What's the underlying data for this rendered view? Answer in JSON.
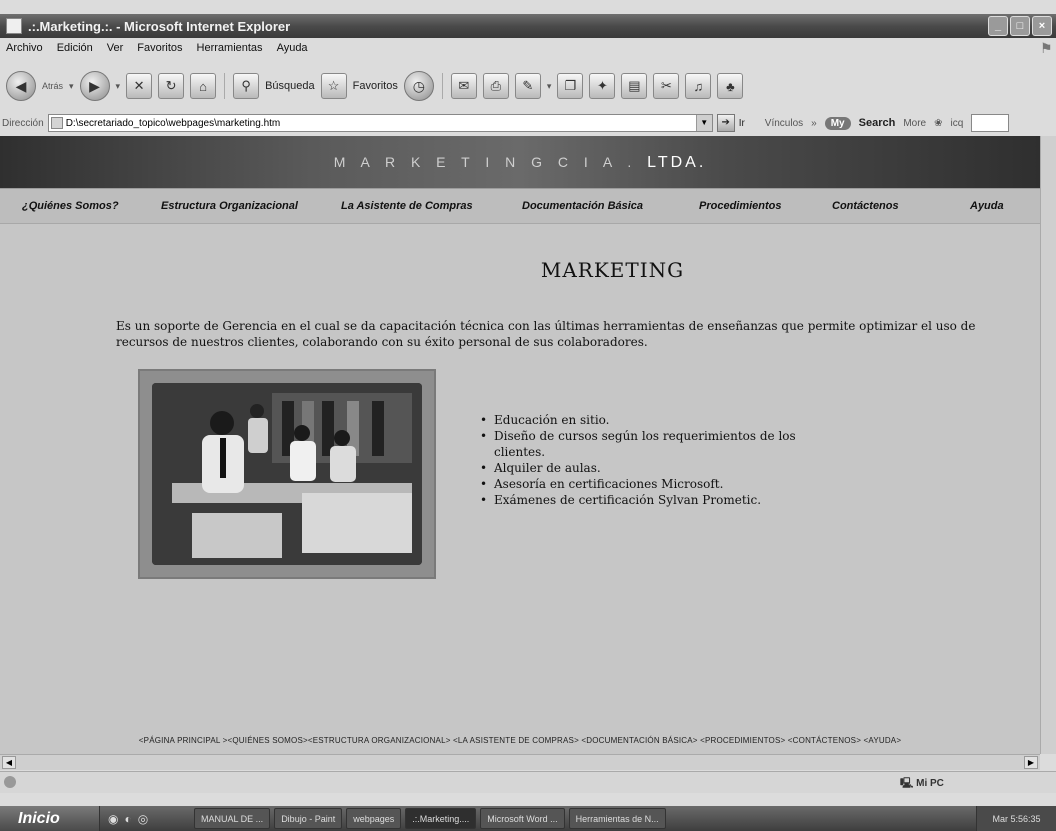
{
  "window": {
    "title": ".:.Marketing.:. - Microsoft Internet Explorer",
    "controls": [
      "_",
      "□",
      "×"
    ]
  },
  "menu": [
    "Archivo",
    "Edición",
    "Ver",
    "Favoritos",
    "Herramientas",
    "Ayuda"
  ],
  "toolbar": {
    "back_label": "Atrás",
    "search_label": "Búsqueda",
    "favorites_label": "Favoritos"
  },
  "addressbar": {
    "label": "Dirección",
    "value": "D:\\secretariado_topico\\webpages\\marketing.htm",
    "go_label": "Ir",
    "links_label": "Vínculos",
    "chevron": "»",
    "search_brand": "My",
    "search_label": "Search",
    "more_label": "More",
    "icq_label": "icq"
  },
  "page": {
    "banner_dim": "M A R K E T I N G   C I A .",
    "banner_bright": "LTDA.",
    "nav": [
      "¿Quiénes Somos?",
      "Estructura Organizacional",
      "La Asistente de Compras",
      "Documentación Básica",
      "Procedimientos",
      "Contáctenos",
      "Ayuda"
    ],
    "heading": "MARKETING",
    "intro": "Es un soporte de Gerencia en el cual se da capacitación técnica con las últimas herramientas de enseñanzas que permite optimizar el uso de recursos de nuestros clientes, colaborando con su éxito personal de sus colaboradores.",
    "features": [
      "Educación en sitio.",
      "Diseño de cursos según los requerimientos de los clientes.",
      "Alquiler de aulas.",
      "Asesoría en certificaciones Microsoft.",
      "Exámenes de certificación Sylvan Prometic."
    ],
    "footer_links": "<PÁGINA PRINCIPAL ><QUIÉNES SOMOS><ESTRUCTURA ORGANIZACIONAL> <LA ASISTENTE DE COMPRAS> <DOCUMENTACIÓN BÁSICA> <PROCEDIMIENTOS> <CONTÁCTENOS> <AYUDA>"
  },
  "statusbar": {
    "zone": "Mi PC"
  },
  "taskbar": {
    "start_label": "Inicio",
    "tasks": [
      "MANUAL DE ...",
      "Dibujo - Paint",
      "webpages",
      ".:.Marketing....",
      "Microsoft Word ...",
      "Herramientas de N..."
    ],
    "clock": "Mar 5:56:35"
  },
  "colors": {
    "banner_dark": "#2f2f2f",
    "nav_bg": "#bdbdbd",
    "page_bg": "#c6c6c6"
  }
}
